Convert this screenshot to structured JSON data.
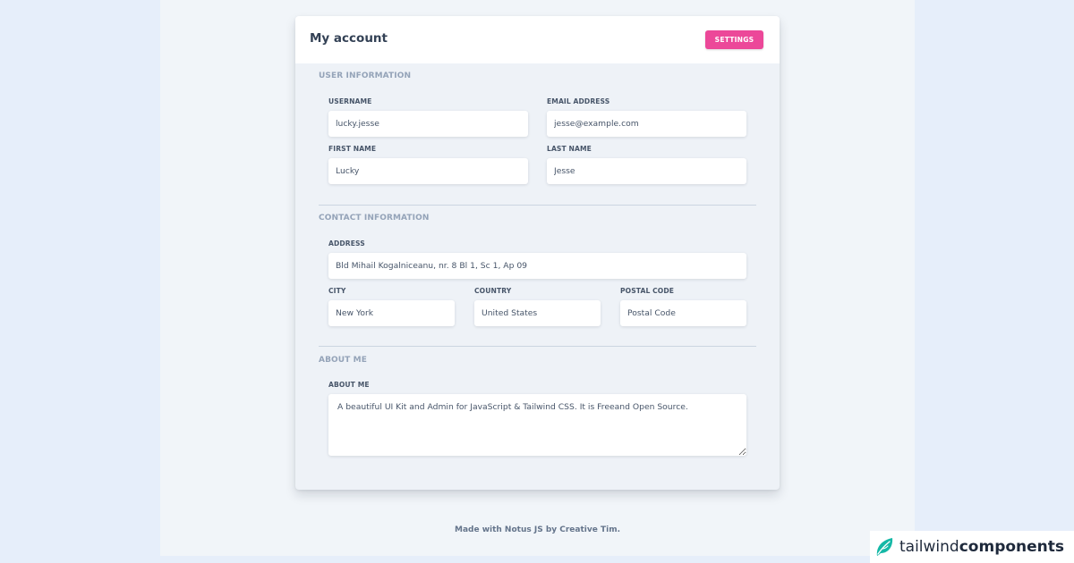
{
  "card": {
    "title": "My account",
    "settings_label": "SETTINGS"
  },
  "sections": {
    "user_info": "USER INFORMATION",
    "contact_info": "CONTACT INFORMATION",
    "about_me": "ABOUT ME"
  },
  "fields": {
    "username": {
      "label": "USERNAME",
      "value": "lucky.jesse"
    },
    "email": {
      "label": "EMAIL ADDRESS",
      "value": "jesse@example.com"
    },
    "first_name": {
      "label": "FIRST NAME",
      "value": "Lucky"
    },
    "last_name": {
      "label": "LAST NAME",
      "value": "Jesse"
    },
    "address": {
      "label": "ADDRESS",
      "value": "Bld Mihail Kogalniceanu, nr. 8 Bl 1, Sc 1, Ap 09"
    },
    "city": {
      "label": "CITY",
      "value": "New York"
    },
    "country": {
      "label": "COUNTRY",
      "value": "United States"
    },
    "postal_code": {
      "label": "POSTAL CODE",
      "value": "Postal Code"
    },
    "about": {
      "label": "ABOUT ME",
      "value": "A beautiful UI Kit and Admin for JavaScript & Tailwind CSS. It is Freeand Open Source."
    }
  },
  "footer": {
    "text": "Made with Notus JS by Creative Tim."
  },
  "brand": {
    "light": "tailwind",
    "bold": "components",
    "icon": "leaf-icon"
  },
  "colors": {
    "accent": "#ec4899",
    "brand_leaf": "#14b8a6"
  }
}
